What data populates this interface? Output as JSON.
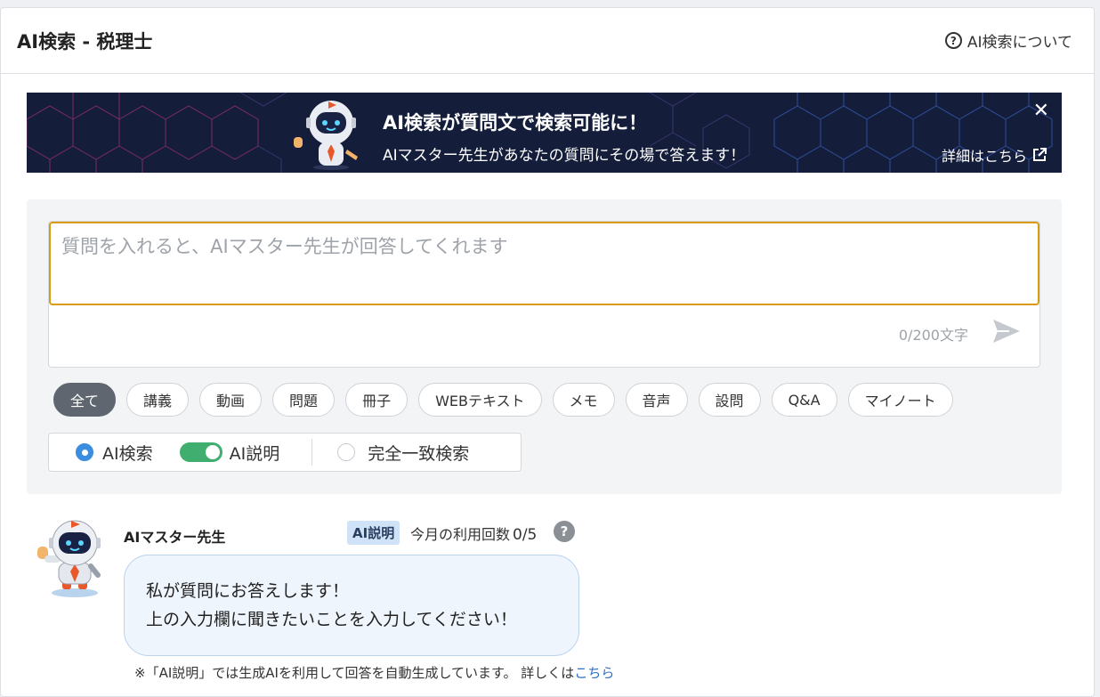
{
  "header": {
    "title": "AI検索 - 税理士",
    "about_label": "AI検索について"
  },
  "banner": {
    "title": "AI検索が質問文で検索可能に！",
    "subtitle": "AIマスター先生があなたの質問にその場で答えます！",
    "detail_label": "詳細はこちら",
    "close_icon": "close-icon",
    "colors": {
      "background": "#141d3a",
      "accent_pink": "#d2368f",
      "accent_blue": "#3c64c8"
    }
  },
  "search": {
    "placeholder": "質問を入れると、AIマスター先生が回答してくれます",
    "char_count": "0/200文字",
    "focus_color": "#d99a14",
    "send_icon": "send-icon"
  },
  "filters": [
    {
      "label": "全て",
      "active": true
    },
    {
      "label": "講義",
      "active": false
    },
    {
      "label": "動画",
      "active": false
    },
    {
      "label": "問題",
      "active": false
    },
    {
      "label": "冊子",
      "active": false
    },
    {
      "label": "WEBテキスト",
      "active": false
    },
    {
      "label": "メモ",
      "active": false
    },
    {
      "label": "音声",
      "active": false
    },
    {
      "label": "設問",
      "active": false
    },
    {
      "label": "Q&A",
      "active": false
    },
    {
      "label": "マイノート",
      "active": false
    }
  ],
  "modes": {
    "ai_search": "AI検索",
    "ai_explain": "AI説明",
    "exact_match": "完全一致検索",
    "selected": "ai_search",
    "ai_explain_enabled": true
  },
  "answer": {
    "teacher_name": "AIマスター先生",
    "badge": "AI説明",
    "usage_label": "今月の利用回数",
    "usage_count": "0/5",
    "message_line1": "私が質問にお答えします！",
    "message_line2": "上の入力欄に聞きたいことを入力してください！",
    "note_text": "※「AI説明」では生成AIを利用して回答を自動生成しています。 詳しくは",
    "note_link": "こちら"
  }
}
